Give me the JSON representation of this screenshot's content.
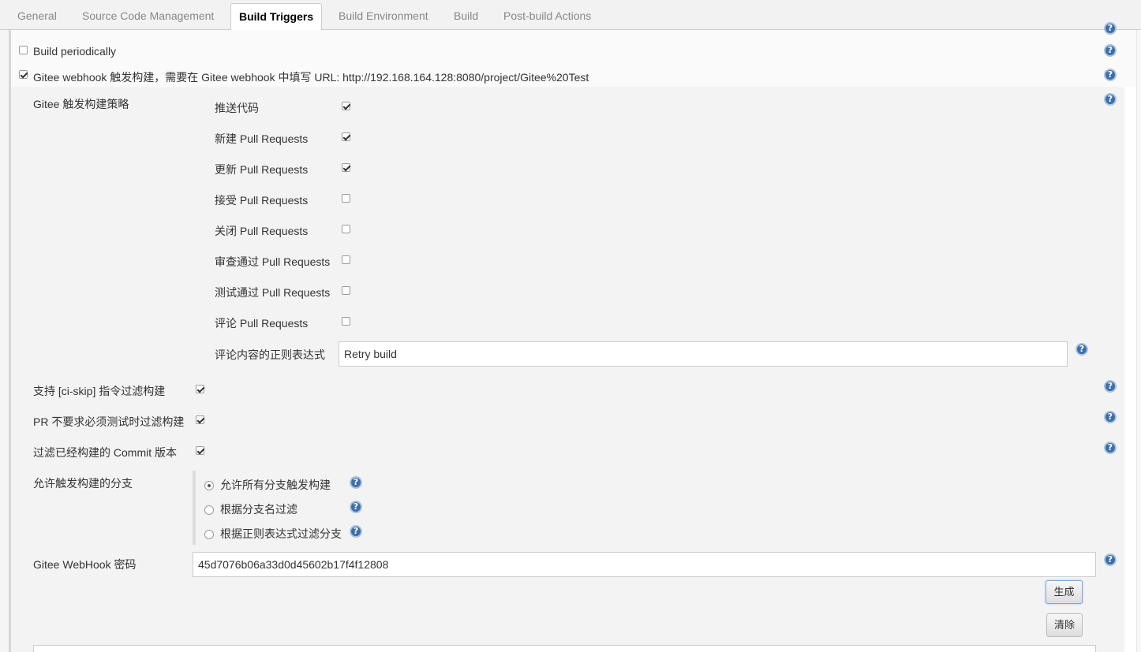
{
  "tabs": [
    {
      "label": "General",
      "active": false
    },
    {
      "label": "Source Code Management",
      "active": false
    },
    {
      "label": "Build Triggers",
      "active": true
    },
    {
      "label": "Build Environment",
      "active": false
    },
    {
      "label": "Build",
      "active": false
    },
    {
      "label": "Post-build Actions",
      "active": false
    }
  ],
  "triggers": {
    "build_periodically": {
      "label": "Build periodically",
      "checked": false
    },
    "gitee_webhook": {
      "label": "Gitee webhook 触发构建，需要在 Gitee webhook 中填写 URL: http://192.168.164.128:8080/project/Gitee%20Test",
      "checked": true
    }
  },
  "gitee": {
    "strategy_label": "Gitee 触发构建策略",
    "strategy_items": [
      {
        "label": "推送代码",
        "checked": true
      },
      {
        "label": "新建 Pull Requests",
        "checked": true
      },
      {
        "label": "更新 Pull Requests",
        "checked": true
      },
      {
        "label": "接受 Pull Requests",
        "checked": false
      },
      {
        "label": "关闭 Pull Requests",
        "checked": false
      },
      {
        "label": "审查通过 Pull Requests",
        "checked": false
      },
      {
        "label": "测试通过 Pull Requests",
        "checked": false
      },
      {
        "label": "评论 Pull Requests",
        "checked": false
      }
    ],
    "comment_regex_label": "评论内容的正则表达式",
    "comment_regex_value": "Retry build",
    "ci_skip": {
      "label": "支持 [ci-skip] 指令过滤构建",
      "checked": true
    },
    "pr_no_test": {
      "label": "PR 不要求必须测试时过滤构建",
      "checked": true
    },
    "filter_built_commit": {
      "label": "过滤已经构建的 Commit 版本",
      "checked": true
    },
    "branches_label": "允许触发构建的分支",
    "branch_options": [
      {
        "label": "允许所有分支触发构建",
        "selected": true
      },
      {
        "label": "根据分支名过滤",
        "selected": false
      },
      {
        "label": "根据正则表达式过滤分支",
        "selected": false
      }
    ],
    "webhook_secret_label": "Gitee WebHook 密码",
    "webhook_secret_value": "45d7076b06a33d0d45602b17f4f12808",
    "generate_button": "生成",
    "clear_button": "清除"
  },
  "icons": {
    "help": "?"
  },
  "colors": {
    "help_blue": "#3d6ea8",
    "active_tab_text": "#000000",
    "inactive_tab_text": "#888888"
  }
}
